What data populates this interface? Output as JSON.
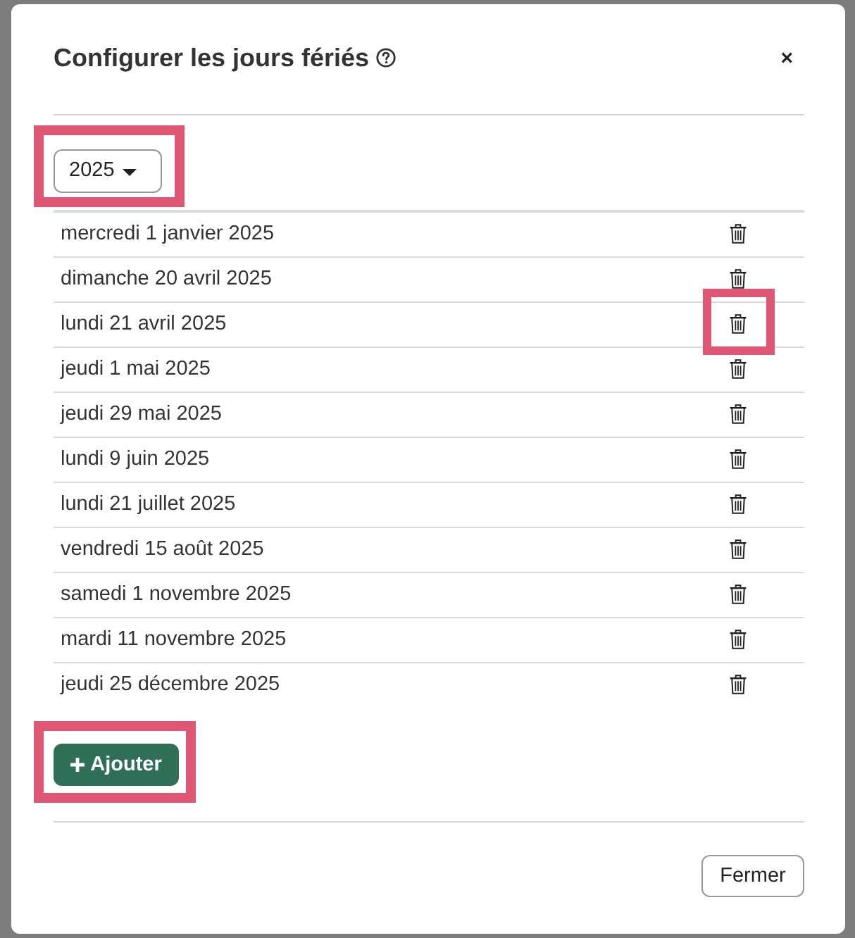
{
  "dialog": {
    "title": "Configurer les jours fériés",
    "close": "×"
  },
  "year_select": {
    "value": "2025",
    "highlighted": true
  },
  "holidays": [
    {
      "date": "mercredi 1 janvier 2025",
      "highlighted": false
    },
    {
      "date": "dimanche 20 avril 2025",
      "highlighted": false
    },
    {
      "date": "lundi 21 avril 2025",
      "highlighted": true
    },
    {
      "date": "jeudi 1 mai 2025",
      "highlighted": false
    },
    {
      "date": "jeudi 29 mai 2025",
      "highlighted": false
    },
    {
      "date": "lundi 9 juin 2025",
      "highlighted": false
    },
    {
      "date": "lundi 21 juillet 2025",
      "highlighted": false
    },
    {
      "date": "vendredi 15 août 2025",
      "highlighted": false
    },
    {
      "date": "samedi 1 novembre 2025",
      "highlighted": false
    },
    {
      "date": "mardi 11 novembre 2025",
      "highlighted": false
    },
    {
      "date": "jeudi 25 décembre 2025",
      "highlighted": false
    }
  ],
  "add_button": {
    "label": "Ajouter",
    "highlighted": true
  },
  "footer": {
    "close_button": "Fermer"
  }
}
